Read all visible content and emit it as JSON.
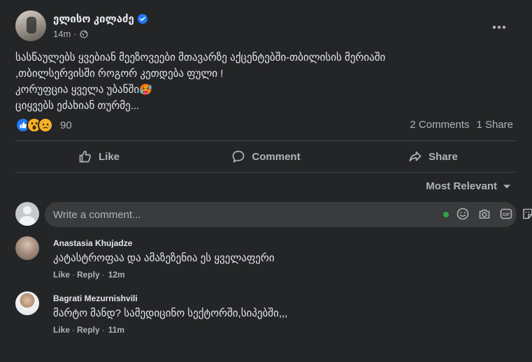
{
  "post": {
    "author": "ელისო კილაძე",
    "time": "14m",
    "body_lines": [
      "სასწაულებს ყვებიან მეეზოვეები მთავარზე  აქცენტებში-თბილისის მერიაში",
      ",თბილსერვისში როგორ კეთდება ფული !",
      "კორუფცია ყველა უბანში🥵",
      "ციყვებს ეძახიან თურმე..."
    ],
    "reaction_count": "90",
    "comments_count": "2 Comments",
    "shares_count": "1 Share"
  },
  "actions": {
    "like": "Like",
    "comment": "Comment",
    "share": "Share"
  },
  "sort": {
    "label": "Most Relevant"
  },
  "composer": {
    "placeholder": "Write a comment..."
  },
  "comments": [
    {
      "name": "Anastasia Khujadze",
      "text": "კატასტროფაა და ამაზეზენია ეს ყველაფერი",
      "like": "Like",
      "reply": "Reply",
      "time": "12m"
    },
    {
      "name": "Bagrati Mezurnishvili",
      "text": "მარტო მანდ? სამედიცინო სექტორში,სიპებში,,,",
      "like": "Like",
      "reply": "Reply",
      "time": "11m"
    }
  ],
  "icons": {
    "verified": "verified-badge-icon",
    "privacy": "globe-icon",
    "more": "more-horizontal-icon",
    "like": "thumbs-up-icon",
    "comment": "comment-bubble-icon",
    "share": "share-arrow-icon",
    "sort": "caret-down-icon",
    "emoji": "smiley-icon",
    "camera": "camera-icon",
    "gif": "gif-icon",
    "sticker": "sticker-icon"
  },
  "colors": {
    "background": "#242526",
    "accent": "#2078f4",
    "online": "#31a24c"
  }
}
